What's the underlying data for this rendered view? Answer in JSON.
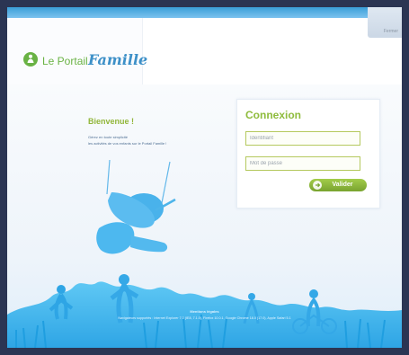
{
  "top_bar": {
    "close_label": "Fermer"
  },
  "logo": {
    "le_text": "Le Portail",
    "famille_text": "Famille"
  },
  "welcome": {
    "title": "Bienvenue !",
    "line1": "Gérez en toute simplicité",
    "line2": "les activités de vos enfants sur le Portail Famille !"
  },
  "login": {
    "title": "Connexion",
    "username_placeholder": "Identifiant",
    "password_placeholder": "Mot de passe",
    "validate_label": "Valider"
  },
  "footer": {
    "name": "Mentions légales",
    "note": "Navigateurs supportés : Internet Explorer 7.0 (IE8, 7.1.0), Firefox 10.0.1, Google Chrome 18.0 (17.0), Apple Safari 5.1"
  },
  "colors": {
    "accent_green": "#8fbc3d",
    "brand_blue": "#3d90c8",
    "silhouette_blue": "#34aee8"
  },
  "icons": {
    "logo": "logo-person-icon",
    "validate": "arrow-right-icon"
  }
}
